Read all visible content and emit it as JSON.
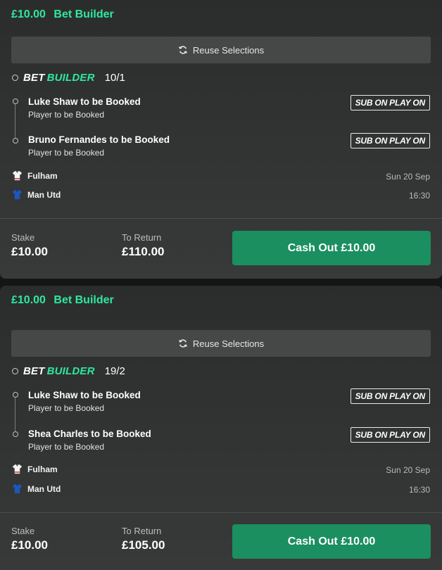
{
  "bets": [
    {
      "stake_header": "£10.00",
      "type_header": "Bet Builder",
      "reuse_label": "Reuse Selections",
      "bb_word1": "BET",
      "bb_word2": "BUILDER",
      "odds": "10/1",
      "selections": [
        {
          "name": "Luke Shaw to be Booked",
          "market": "Player to be Booked",
          "badge": "SUB ON PLAY ON"
        },
        {
          "name": "Bruno Fernandes to be Booked",
          "market": "Player to be Booked",
          "badge": "SUB ON PLAY ON"
        }
      ],
      "home_team": "Fulham",
      "away_team": "Man Utd",
      "date": "Sun 20 Sep",
      "time": "16:30",
      "stake_label": "Stake",
      "stake_value": "£10.00",
      "return_label": "To Return",
      "return_value": "£110.00",
      "cashout_label": "Cash Out £10.00"
    },
    {
      "stake_header": "£10.00",
      "type_header": "Bet Builder",
      "reuse_label": "Reuse Selections",
      "bb_word1": "BET",
      "bb_word2": "BUILDER",
      "odds": "19/2",
      "selections": [
        {
          "name": "Luke Shaw to be Booked",
          "market": "Player to be Booked",
          "badge": "SUB ON PLAY ON"
        },
        {
          "name": "Shea Charles to be Booked",
          "market": "Player to be Booked",
          "badge": "SUB ON PLAY ON"
        }
      ],
      "home_team": "Fulham",
      "away_team": "Man Utd",
      "date": "Sun 20 Sep",
      "time": "16:30",
      "stake_label": "Stake",
      "stake_value": "£10.00",
      "return_label": "To Return",
      "return_value": "£105.00",
      "cashout_label": "Cash Out £10.00"
    }
  ],
  "icons": {
    "reuse": "refresh-icon",
    "home_kit": "fulham-shirt-icon",
    "away_kit": "man-utd-shirt-icon"
  },
  "colors": {
    "accent": "#2ee8a1",
    "cashout": "#1b8f5f"
  }
}
